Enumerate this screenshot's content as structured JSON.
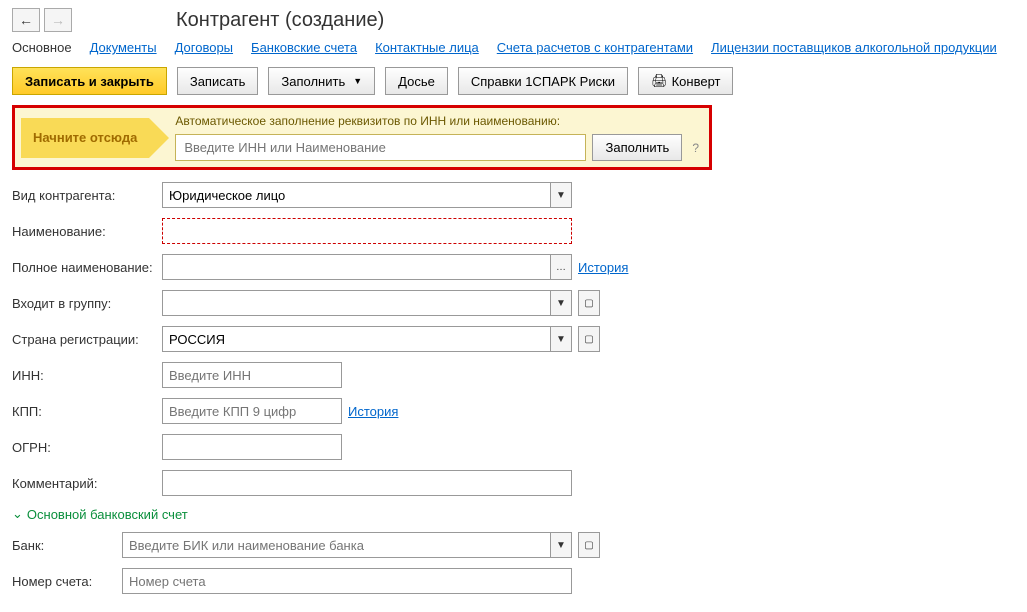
{
  "header": {
    "title": "Контрагент (создание)"
  },
  "tabs": [
    {
      "label": "Основное",
      "active": true
    },
    {
      "label": "Документы"
    },
    {
      "label": "Договоры"
    },
    {
      "label": "Банковские счета"
    },
    {
      "label": "Контактные лица"
    },
    {
      "label": "Счета расчетов с контрагентами"
    },
    {
      "label": "Лицензии поставщиков алкогольной продукции"
    }
  ],
  "toolbar": {
    "save_close": "Записать и закрыть",
    "save": "Записать",
    "fill": "Заполнить",
    "dossier": "Досье",
    "spark": "Справки 1СПАРК Риски",
    "envelope": "Конверт"
  },
  "cta": {
    "start_here": "Начните отсюда",
    "auto_fill_label": "Автоматическое заполнение реквизитов по ИНН или наименованию:",
    "placeholder": "Введите ИНН или Наименование",
    "fill_btn": "Заполнить",
    "help": "?"
  },
  "form": {
    "type_label": "Вид контрагента:",
    "type_value": "Юридическое лицо",
    "name_label": "Наименование:",
    "fullname_label": "Полное наименование:",
    "history": "История",
    "group_label": "Входит в группу:",
    "country_label": "Страна регистрации:",
    "country_value": "РОССИЯ",
    "inn_label": "ИНН:",
    "inn_placeholder": "Введите ИНН",
    "kpp_label": "КПП:",
    "kpp_placeholder": "Введите КПП 9 цифр",
    "ogrn_label": "ОГРН:",
    "comment_label": "Комментарий:"
  },
  "bank": {
    "section": "Основной банковский счет",
    "bank_label": "Банк:",
    "bank_placeholder": "Введите БИК или наименование банка",
    "account_label": "Номер счета:",
    "account_placeholder": "Номер счета"
  }
}
